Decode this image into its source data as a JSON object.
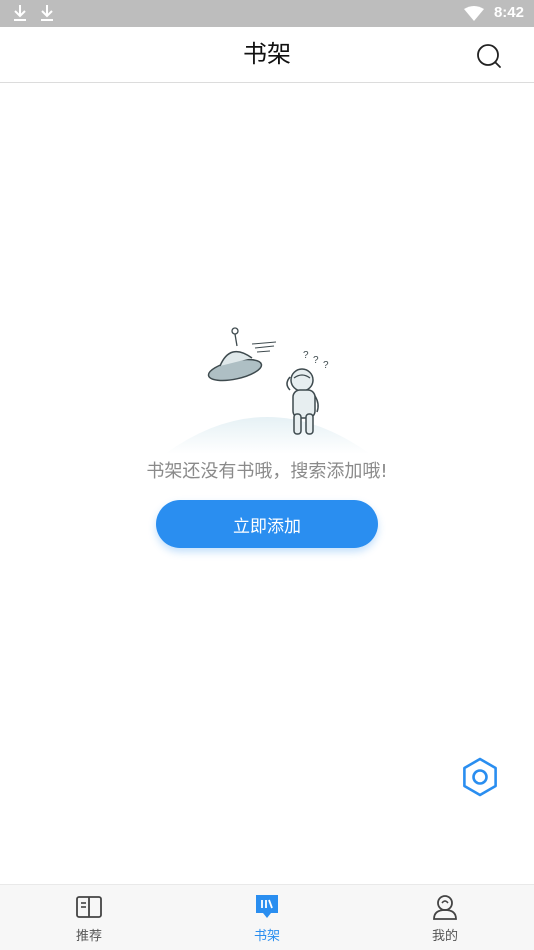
{
  "status_bar": {
    "time": "8:42",
    "icons": [
      "download-icon",
      "download-icon",
      "wifi-icon"
    ]
  },
  "header": {
    "title": "书架",
    "search_icon": "search-icon"
  },
  "empty_state": {
    "illustration": "ufo-astronaut-illustration",
    "message": "书架还没有书哦，搜索添加哦!",
    "button_label": "立即添加"
  },
  "settings_fab": {
    "icon": "gear-icon"
  },
  "bottom_nav": {
    "items": [
      {
        "label": "推荐",
        "icon": "book-open-icon",
        "active": false
      },
      {
        "label": "书架",
        "icon": "bookshelf-icon",
        "active": true
      },
      {
        "label": "我的",
        "icon": "profile-icon",
        "active": false
      }
    ]
  },
  "colors": {
    "accent": "#2a8ef0",
    "status_bar": "#bdbdbd",
    "muted_text": "#8a8a8a"
  }
}
